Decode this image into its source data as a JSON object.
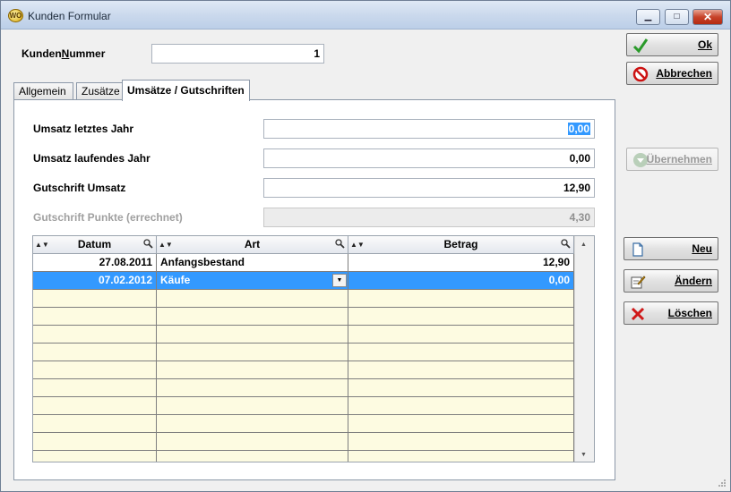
{
  "window": {
    "title": "Kunden Formular",
    "app_icon_text": "WO",
    "minimize": "▁",
    "maximize": "□",
    "close": "✕"
  },
  "form": {
    "kundennummer_label_pre": "Kunden",
    "kundennummer_label_u": "N",
    "kundennummer_label_post": "ummer",
    "kundennummer_value": "1"
  },
  "tabs": [
    {
      "label": "Allgemein"
    },
    {
      "label": "Zusätze"
    },
    {
      "label": "Umsätze / Gutschriften"
    }
  ],
  "fields": {
    "umsatz_letztes_jahr": {
      "label": "Umsatz letztes Jahr",
      "value": "0,00"
    },
    "umsatz_laufendes_jahr": {
      "label": "Umsatz laufendes Jahr",
      "value": "0,00"
    },
    "gutschrift_umsatz": {
      "label": "Gutschrift Umsatz",
      "value": "12,90"
    },
    "gutschrift_punkte": {
      "label": "Gutschrift Punkte (errechnet)",
      "value": "4,30"
    }
  },
  "buttons": {
    "ok": "Ok",
    "abbrechen": "Abbrechen",
    "uebernehmen": "Übernehmen",
    "neu": "Neu",
    "aendern": "Ändern",
    "loeschen": "Löschen"
  },
  "table": {
    "columns": [
      "Datum",
      "Art",
      "Betrag"
    ],
    "rows": [
      {
        "datum": "27.08.2011",
        "art": "Anfangsbestand",
        "betrag": "12,90"
      },
      {
        "datum": "07.02.2012",
        "art": "Käufe",
        "betrag": "0,00"
      }
    ],
    "scroll_up": "▲",
    "scroll_down": "▼"
  }
}
